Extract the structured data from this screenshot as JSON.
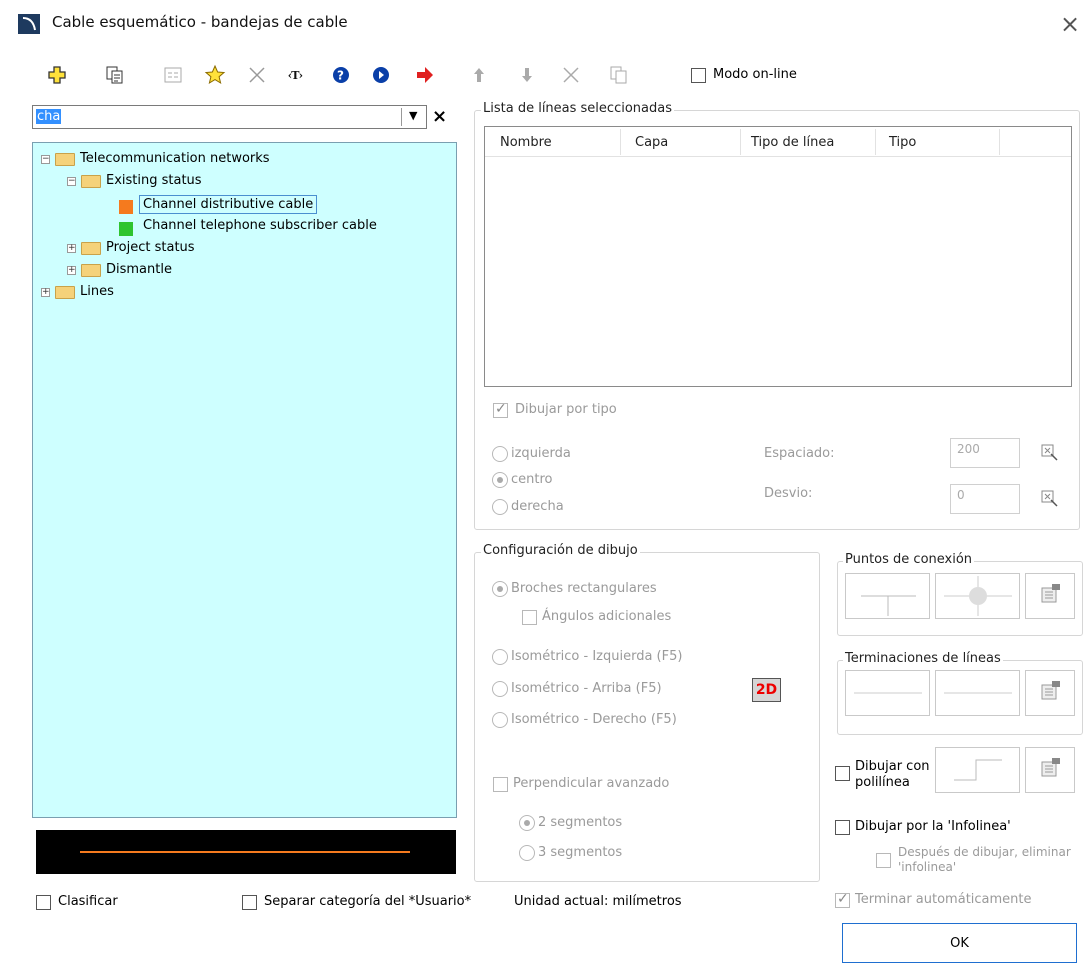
{
  "window": {
    "title": "Cable esquemático - bandejas de cable"
  },
  "toolbar": {
    "icons": [
      "add-icon",
      "copy-icon",
      "properties-icon",
      "favorite-star-icon",
      "delete-icon",
      "text-tag-icon",
      "help-icon",
      "info-icon",
      "arrow-right-icon",
      "move-up-icon",
      "move-down-icon",
      "remove-icon",
      "paste-icon"
    ],
    "online_mode_label": "Modo on-line"
  },
  "search": {
    "value": "cha"
  },
  "tree": {
    "root": "Telecommunication networks",
    "existing": "Existing status",
    "item1": "Channel distributive cable",
    "item1_color": "#f57a1e",
    "item2": "Channel telephone subscriber cable",
    "item2_color": "#2fc42f",
    "project": "Project status",
    "dismantle": "Dismantle",
    "lines": "Lines"
  },
  "preview": {
    "line_color": "#f57a1e"
  },
  "bottom_left": {
    "classify": "Clasificar",
    "separate": "Separar categoría del *Usuario*",
    "unit": "Unidad actual: milímetros"
  },
  "line_list": {
    "legend": "Lista de líneas seleccionadas",
    "columns": [
      "Nombre",
      "Capa",
      "Tipo de línea",
      "Tipo"
    ],
    "draw_by_type": "Dibujar por tipo",
    "left": "izquierda",
    "center": "centro",
    "right": "derecha",
    "spacing_label": "Espaciado:",
    "spacing_value": "200",
    "offset_label": "Desvio:",
    "offset_value": "0"
  },
  "drawing_config": {
    "legend": "Configuración de dibujo",
    "rect": "Broches rectangulares",
    "extra_angles": "Ángulos adicionales",
    "iso_left": "Isométrico - Izquierda (F5)",
    "iso_top": "Isométrico - Arriba (F5)",
    "iso_right": "Isométrico - Derecho (F5)",
    "mode_badge": "2D",
    "advanced_perp": "Perpendicular avanzado",
    "seg2": "2 segmentos",
    "seg3": "3 segmentos"
  },
  "connection_points": {
    "legend": "Puntos de conexión"
  },
  "line_endings": {
    "legend": "Terminaciones de líneas"
  },
  "polyline": {
    "label1": "Dibujar con",
    "label2": "polilínea"
  },
  "infoline": {
    "label": "Dibujar por la 'Infolinea'",
    "after1": "Después de dibujar, eliminar",
    "after2": "'infolinea'"
  },
  "auto_finish": "Terminar automáticamente",
  "ok": "OK"
}
